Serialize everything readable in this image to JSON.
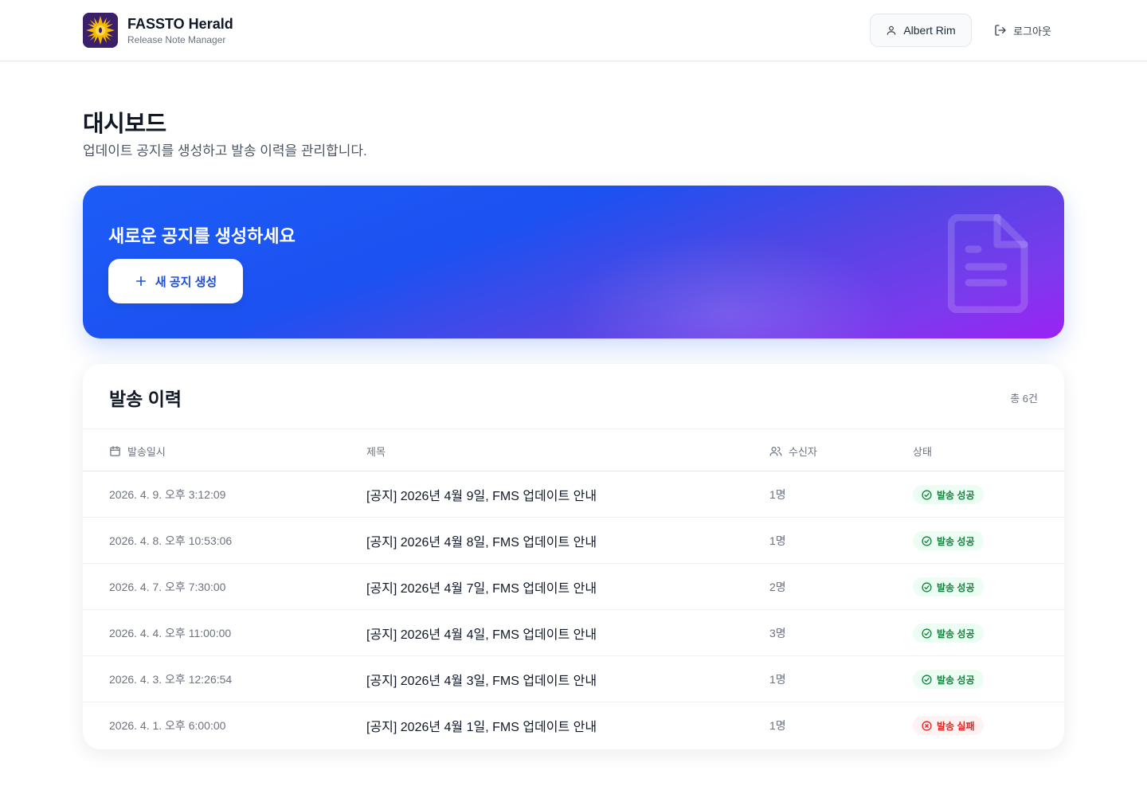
{
  "header": {
    "app_title": "FASSTO Herald",
    "app_subtitle": "Release Note Manager",
    "user_name": "Albert Rim",
    "logout_label": "로그아웃"
  },
  "page": {
    "title": "대시보드",
    "description": "업데이트 공지를 생성하고 발송 이력을 관리합니다."
  },
  "banner": {
    "title": "새로운 공지를 생성하세요",
    "button_label": "새 공지 생성"
  },
  "history": {
    "title": "발송 이력",
    "count_label": "총 6건",
    "columns": {
      "date": "발송일시",
      "subject": "제목",
      "recipients": "수신자",
      "status": "상태"
    },
    "rows": [
      {
        "date": "2026. 4. 9. 오후 3:12:09",
        "subject": "[공지] 2026년 4월 9일, FMS 업데이트 안내",
        "recipients": "1명",
        "status": "발송 성공",
        "status_type": "success"
      },
      {
        "date": "2026. 4. 8. 오후 10:53:06",
        "subject": "[공지] 2026년 4월 8일, FMS 업데이트 안내",
        "recipients": "1명",
        "status": "발송 성공",
        "status_type": "success"
      },
      {
        "date": "2026. 4. 7. 오후 7:30:00",
        "subject": "[공지] 2026년 4월 7일, FMS 업데이트 안내",
        "recipients": "2명",
        "status": "발송 성공",
        "status_type": "success"
      },
      {
        "date": "2026. 4. 4. 오후 11:00:00",
        "subject": "[공지] 2026년 4월 4일, FMS 업데이트 안내",
        "recipients": "3명",
        "status": "발송 성공",
        "status_type": "success"
      },
      {
        "date": "2026. 4. 3. 오후 12:26:54",
        "subject": "[공지] 2026년 4월 3일, FMS 업데이트 안내",
        "recipients": "1명",
        "status": "발송 성공",
        "status_type": "success"
      },
      {
        "date": "2026. 4. 1. 오후 6:00:00",
        "subject": "[공지] 2026년 4월 1일, FMS 업데이트 안내",
        "recipients": "1명",
        "status": "발송 실패",
        "status_type": "fail"
      }
    ]
  },
  "colors": {
    "primary": "#1d5cf7",
    "gradient_end": "#9b22f5",
    "success": "#15803d",
    "fail": "#dc2626"
  },
  "icons": {
    "logo": "sun-logo-icon",
    "user": "user-icon",
    "logout": "logout-icon",
    "add": "plus-icon",
    "banner": "document-icon",
    "date_column": "calendar-icon",
    "recipients_column": "users-icon",
    "success": "check-circle-icon",
    "fail": "x-circle-icon"
  }
}
